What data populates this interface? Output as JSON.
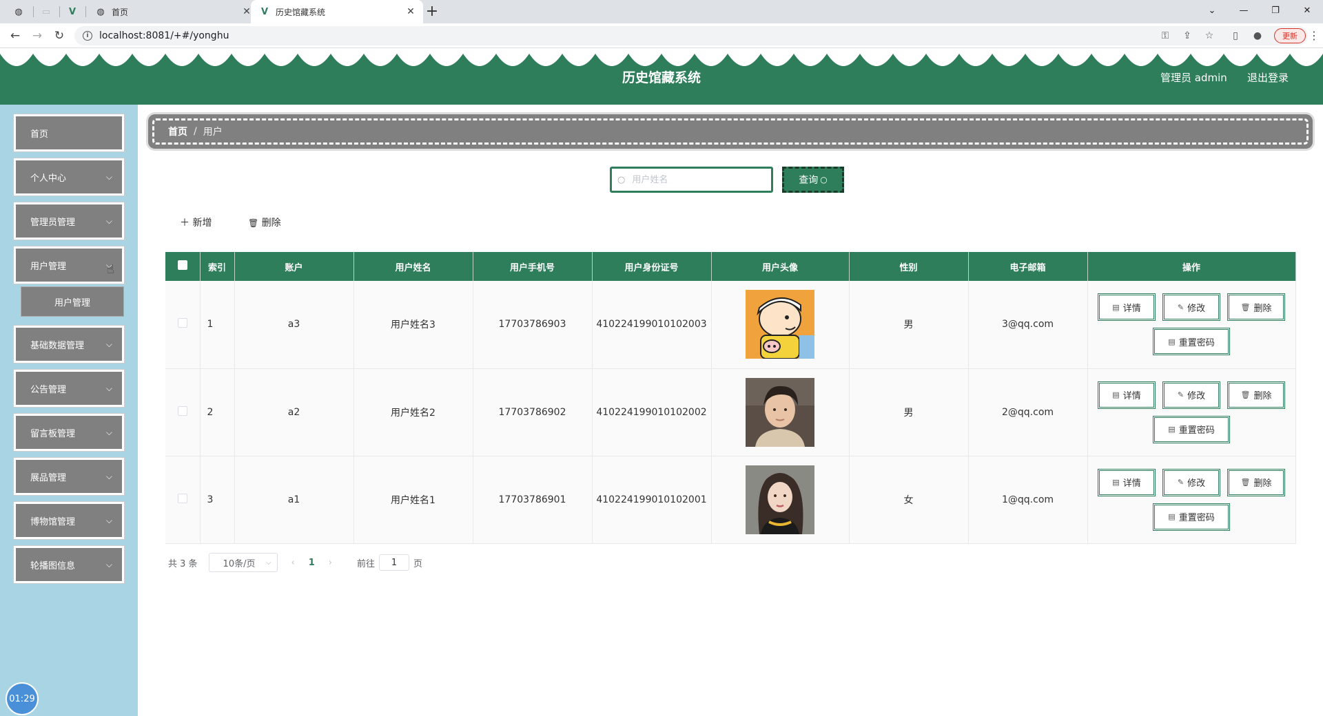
{
  "browser": {
    "tabs": [
      {
        "title": "首页",
        "active": false
      },
      {
        "title": "历史馆藏系统",
        "active": true
      }
    ],
    "url": "localhost:8081/+#/yonghu",
    "update_label": "更新"
  },
  "header": {
    "title": "历史馆藏系统",
    "user_label": "管理员 admin",
    "logout_label": "退出登录"
  },
  "sidebar": {
    "items": [
      {
        "label": "首页",
        "has_children": false
      },
      {
        "label": "个人中心",
        "has_children": true
      },
      {
        "label": "管理员管理",
        "has_children": true
      },
      {
        "label": "用户管理",
        "has_children": true
      },
      {
        "label": "基础数据管理",
        "has_children": true
      },
      {
        "label": "公告管理",
        "has_children": true
      },
      {
        "label": "留言板管理",
        "has_children": true
      },
      {
        "label": "展品管理",
        "has_children": true
      },
      {
        "label": "博物馆管理",
        "has_children": true
      },
      {
        "label": "轮播图信息",
        "has_children": true
      }
    ],
    "open_submenu": {
      "label": "用户管理"
    },
    "timer": "01:29"
  },
  "breadcrumb": {
    "home": "首页",
    "separator": "/",
    "current": "用户"
  },
  "search": {
    "placeholder": "用户姓名",
    "button_label": "查询"
  },
  "actions": {
    "add_label": "新增",
    "delete_label": "删除"
  },
  "table": {
    "columns": [
      "索引",
      "账户",
      "用户姓名",
      "用户手机号",
      "用户身份证号",
      "用户头像",
      "性别",
      "电子邮箱",
      "操作"
    ],
    "rows": [
      {
        "index": "1",
        "account": "a3",
        "name": "用户姓名3",
        "phone": "17703786903",
        "id_card": "410224199010102003",
        "avatar": "cartoon-boy-avatar",
        "gender": "男",
        "email": "3@qq.com"
      },
      {
        "index": "2",
        "account": "a2",
        "name": "用户姓名2",
        "phone": "17703786902",
        "id_card": "410224199010102002",
        "avatar": "young-man-photo-avatar",
        "gender": "男",
        "email": "2@qq.com"
      },
      {
        "index": "3",
        "account": "a1",
        "name": "用户姓名1",
        "phone": "17703786901",
        "id_card": "410224199010102001",
        "avatar": "young-woman-photo-avatar",
        "gender": "女",
        "email": "1@qq.com"
      }
    ],
    "row_actions": {
      "detail": "详情",
      "edit": "修改",
      "delete": "删除",
      "reset_password": "重置密码"
    }
  },
  "pagination": {
    "total": "共 3 条",
    "page_size": "10条/页",
    "current_page": "1",
    "goto_label": "前往",
    "goto_value": "1",
    "page_unit": "页"
  },
  "colors": {
    "primary": "#2e7d5b",
    "sidebar_bg": "#a8d4e4",
    "menu_bg": "#808080"
  }
}
